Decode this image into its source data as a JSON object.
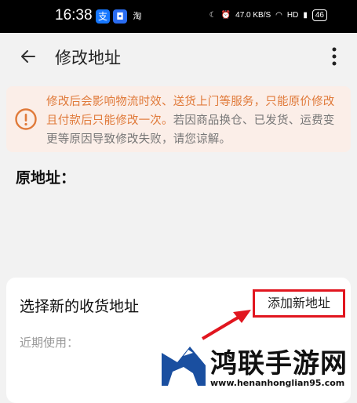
{
  "status_bar": {
    "time": "16:38",
    "app_icons": [
      {
        "name": "alipay-icon",
        "glyph": "支",
        "color": "#1677ff"
      },
      {
        "name": "message-app-icon",
        "glyph": "◘",
        "color": "#2a6cf0"
      },
      {
        "name": "taobao-icon",
        "glyph": "淘",
        "color": "#000000"
      }
    ],
    "net_speed": "47.0 KB/S",
    "battery": "46"
  },
  "header": {
    "title": "修改地址"
  },
  "notice": {
    "highlight": "修改后会影响物流时效、送货上门等服务，只能原价修改且付款后只能修改一次。",
    "detail": "若因商品换仓、已发货、运费变更等原因导致修改失败，请您谅解。",
    "highlight_color": "#e07a3a"
  },
  "original": {
    "label": "原地址："
  },
  "new_address": {
    "title": "选择新的收货地址",
    "add_label": "添加新地址",
    "recent_label": "近期使用："
  },
  "watermark": {
    "title": "鸿联手游网",
    "url": "www.henanhonglian95.com"
  }
}
